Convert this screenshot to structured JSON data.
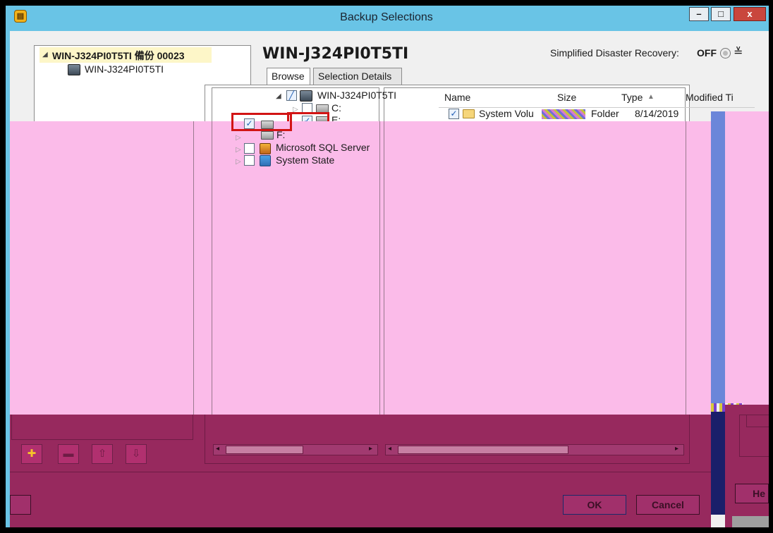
{
  "window": {
    "title": "Backup Selections",
    "min": "–",
    "max": "□",
    "close": "x"
  },
  "left_tree": {
    "root_label": "WIN-J324PI0T5TI 備份 00023",
    "child_label": "WIN-J324PI0T5TI"
  },
  "header": {
    "server_name": "WIN-J324PI0T5TI",
    "sdr_label": "Simplified Disaster Recovery:",
    "sdr_value": "OFF"
  },
  "tabs": [
    "Browse",
    "Selection Details"
  ],
  "tree": {
    "server": "WIN-J324PI0T5TI",
    "items": [
      {
        "label": "C:",
        "checked": false
      },
      {
        "label": "E:",
        "checked": true
      },
      {
        "label": "F:",
        "checked": false
      },
      {
        "label": "Microsoft SQL Server",
        "checked": false
      },
      {
        "label": "System State",
        "checked": false
      }
    ]
  },
  "list": {
    "columns": [
      "Name",
      "Size",
      "Type",
      "Modified Ti"
    ],
    "rows": [
      {
        "name": "System Volu",
        "size": "",
        "type": "Folder",
        "modified": "8/14/2019"
      }
    ]
  },
  "buttons": {
    "ok": "OK",
    "cancel": "Cancel",
    "help": "He"
  }
}
